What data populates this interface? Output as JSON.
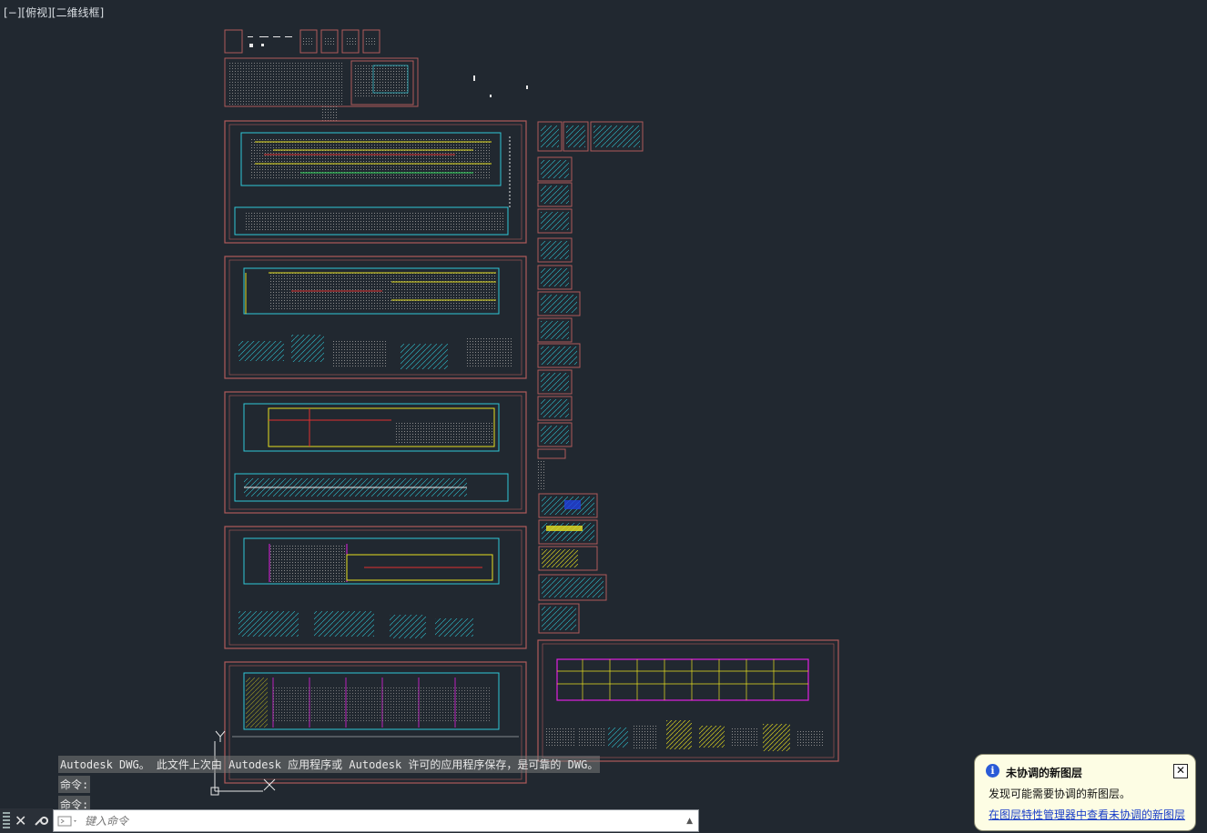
{
  "viewport": {
    "label": "[−][俯视][二维线框]"
  },
  "command_line": {
    "history": [
      "Autodesk DWG。  此文件上次由 Autodesk 应用程序或 Autodesk 许可的应用程序保存，是可靠的 DWG。",
      "命令:",
      "命令:"
    ],
    "placeholder": "键入命令"
  },
  "notification": {
    "title": "未协调的新图层",
    "body": "发现可能需要协调的新图层。",
    "link": "在图层特性管理器中查看未协调的新图层"
  },
  "colors": {
    "background": "#212830",
    "sheet_border": "#b05a5a",
    "cad_cyan": "#33d6e6",
    "cad_yellow": "#e8e020",
    "cad_magenta": "#e020e0",
    "cad_red": "#e03030",
    "cad_white": "#e8e8e8"
  },
  "icons": [
    "ucs-icon",
    "close-icon",
    "wrench-icon",
    "command-icon",
    "info-icon"
  ]
}
